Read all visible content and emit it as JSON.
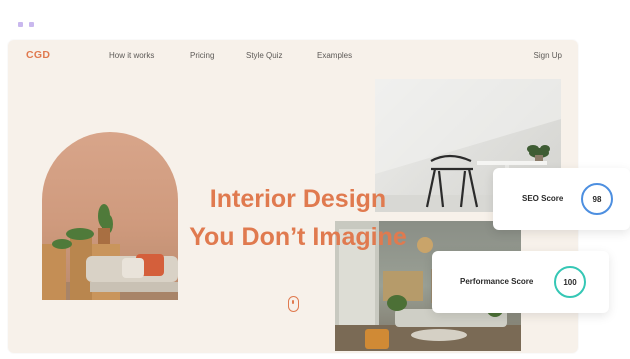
{
  "nav": {
    "logo": "CGD",
    "links": [
      "How it works",
      "Pricing",
      "Style Quiz",
      "Examples"
    ],
    "signup": "Sign Up"
  },
  "hero": {
    "headline_line1": "Interior Design",
    "headline_line2": "You Don’t Imagine"
  },
  "cards": {
    "seo": {
      "label": "SEO Score",
      "score": "98",
      "ring_color": "#4d8fe0"
    },
    "performance": {
      "label": "Performance Score",
      "score": "100",
      "ring_color": "#35c7b5"
    }
  },
  "colors": {
    "accent": "#e07a4f",
    "background": "#f7f1ea"
  }
}
